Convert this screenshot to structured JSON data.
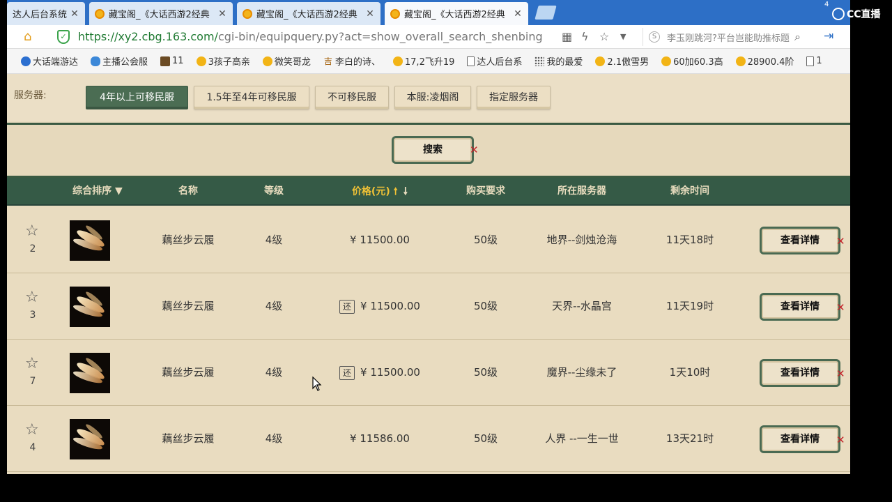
{
  "tabs": [
    {
      "title": "达人后台系统",
      "close": "✕",
      "active": false
    },
    {
      "title": "藏宝阁_《大话西游2经典",
      "close": "✕",
      "active": false
    },
    {
      "title": "藏宝阁_《大话西游2经典",
      "close": "✕",
      "active": false
    },
    {
      "title": "藏宝阁_《大话西游2经典",
      "close": "✕",
      "active": true
    }
  ],
  "address": {
    "url_host": "https://xy2.cbg.163.com/",
    "url_path": "cgi-bin/equipquery.py?act=show_overall_search_shenbing",
    "shield": "✓",
    "search_text": "李玉刚跳河?平台岂能助推标题"
  },
  "bookmarks": [
    {
      "label": "大话端游达",
      "icon": "blue"
    },
    {
      "label": "主播公会服",
      "icon": "cloud"
    },
    {
      "label": "11",
      "icon": "img"
    },
    {
      "label": "3孩子高亲",
      "icon": "gold"
    },
    {
      "label": "微笑哥龙",
      "icon": "gold"
    },
    {
      "label": "李白的诗、",
      "icon": "cn",
      "glyph": "吉"
    },
    {
      "label": "17,2飞升19",
      "icon": "gold"
    },
    {
      "label": "达人后台系",
      "icon": "doc"
    },
    {
      "label": "我的最爱",
      "icon": "grid"
    },
    {
      "label": "2.1傲雪男",
      "icon": "gold"
    },
    {
      "label": "60加60.3高",
      "icon": "gold"
    },
    {
      "label": "28900.4阶",
      "icon": "gold"
    },
    {
      "label": "1",
      "icon": "doc"
    }
  ],
  "server_filter": {
    "label": "服务器:",
    "options": [
      {
        "label": "4年以上可移民服",
        "active": true
      },
      {
        "label": "1.5年至4年可移民服",
        "active": false
      },
      {
        "label": "不可移民服",
        "active": false
      },
      {
        "label": "本服:凌烟阁",
        "active": false
      },
      {
        "label": "指定服务器",
        "active": false
      }
    ]
  },
  "search_label": "搜索",
  "table": {
    "headers": {
      "sort": "综合排序 ▼",
      "name": "名称",
      "level": "等级",
      "price": "价格(元)",
      "requirement": "购买要求",
      "server": "所在服务器",
      "time_left": "剩余时间"
    },
    "rows": [
      {
        "num": "2",
        "name": "藕丝步云履",
        "level": "4级",
        "badge": "",
        "price": "¥ 11500.00",
        "requirement": "50级",
        "server": "地界--剑烛沧海",
        "time_left": "11天18时",
        "action": "查看详情"
      },
      {
        "num": "3",
        "name": "藕丝步云履",
        "level": "4级",
        "badge": "还",
        "price": "¥ 11500.00",
        "requirement": "50级",
        "server": "天界--水晶宫",
        "time_left": "11天19时",
        "action": "查看详情"
      },
      {
        "num": "7",
        "name": "藕丝步云履",
        "level": "4级",
        "badge": "还",
        "price": "¥ 11500.00",
        "requirement": "50级",
        "server": "魔界--尘缘未了",
        "time_left": "1天10时",
        "action": "查看详情"
      },
      {
        "num": "4",
        "name": "藕丝步云履",
        "level": "4级",
        "badge": "",
        "price": "¥ 11586.00",
        "requirement": "50级",
        "server": "人界 --一生一世",
        "time_left": "13天21时",
        "action": "查看详情"
      }
    ]
  },
  "overlay": {
    "logo_text": "CC直播",
    "top_num": "4"
  },
  "colors": {
    "tabbar": "#2d6fc6",
    "header_green": "#355a46",
    "page_bg": "#e9dcc0",
    "price_highlight": "#f1c236"
  }
}
